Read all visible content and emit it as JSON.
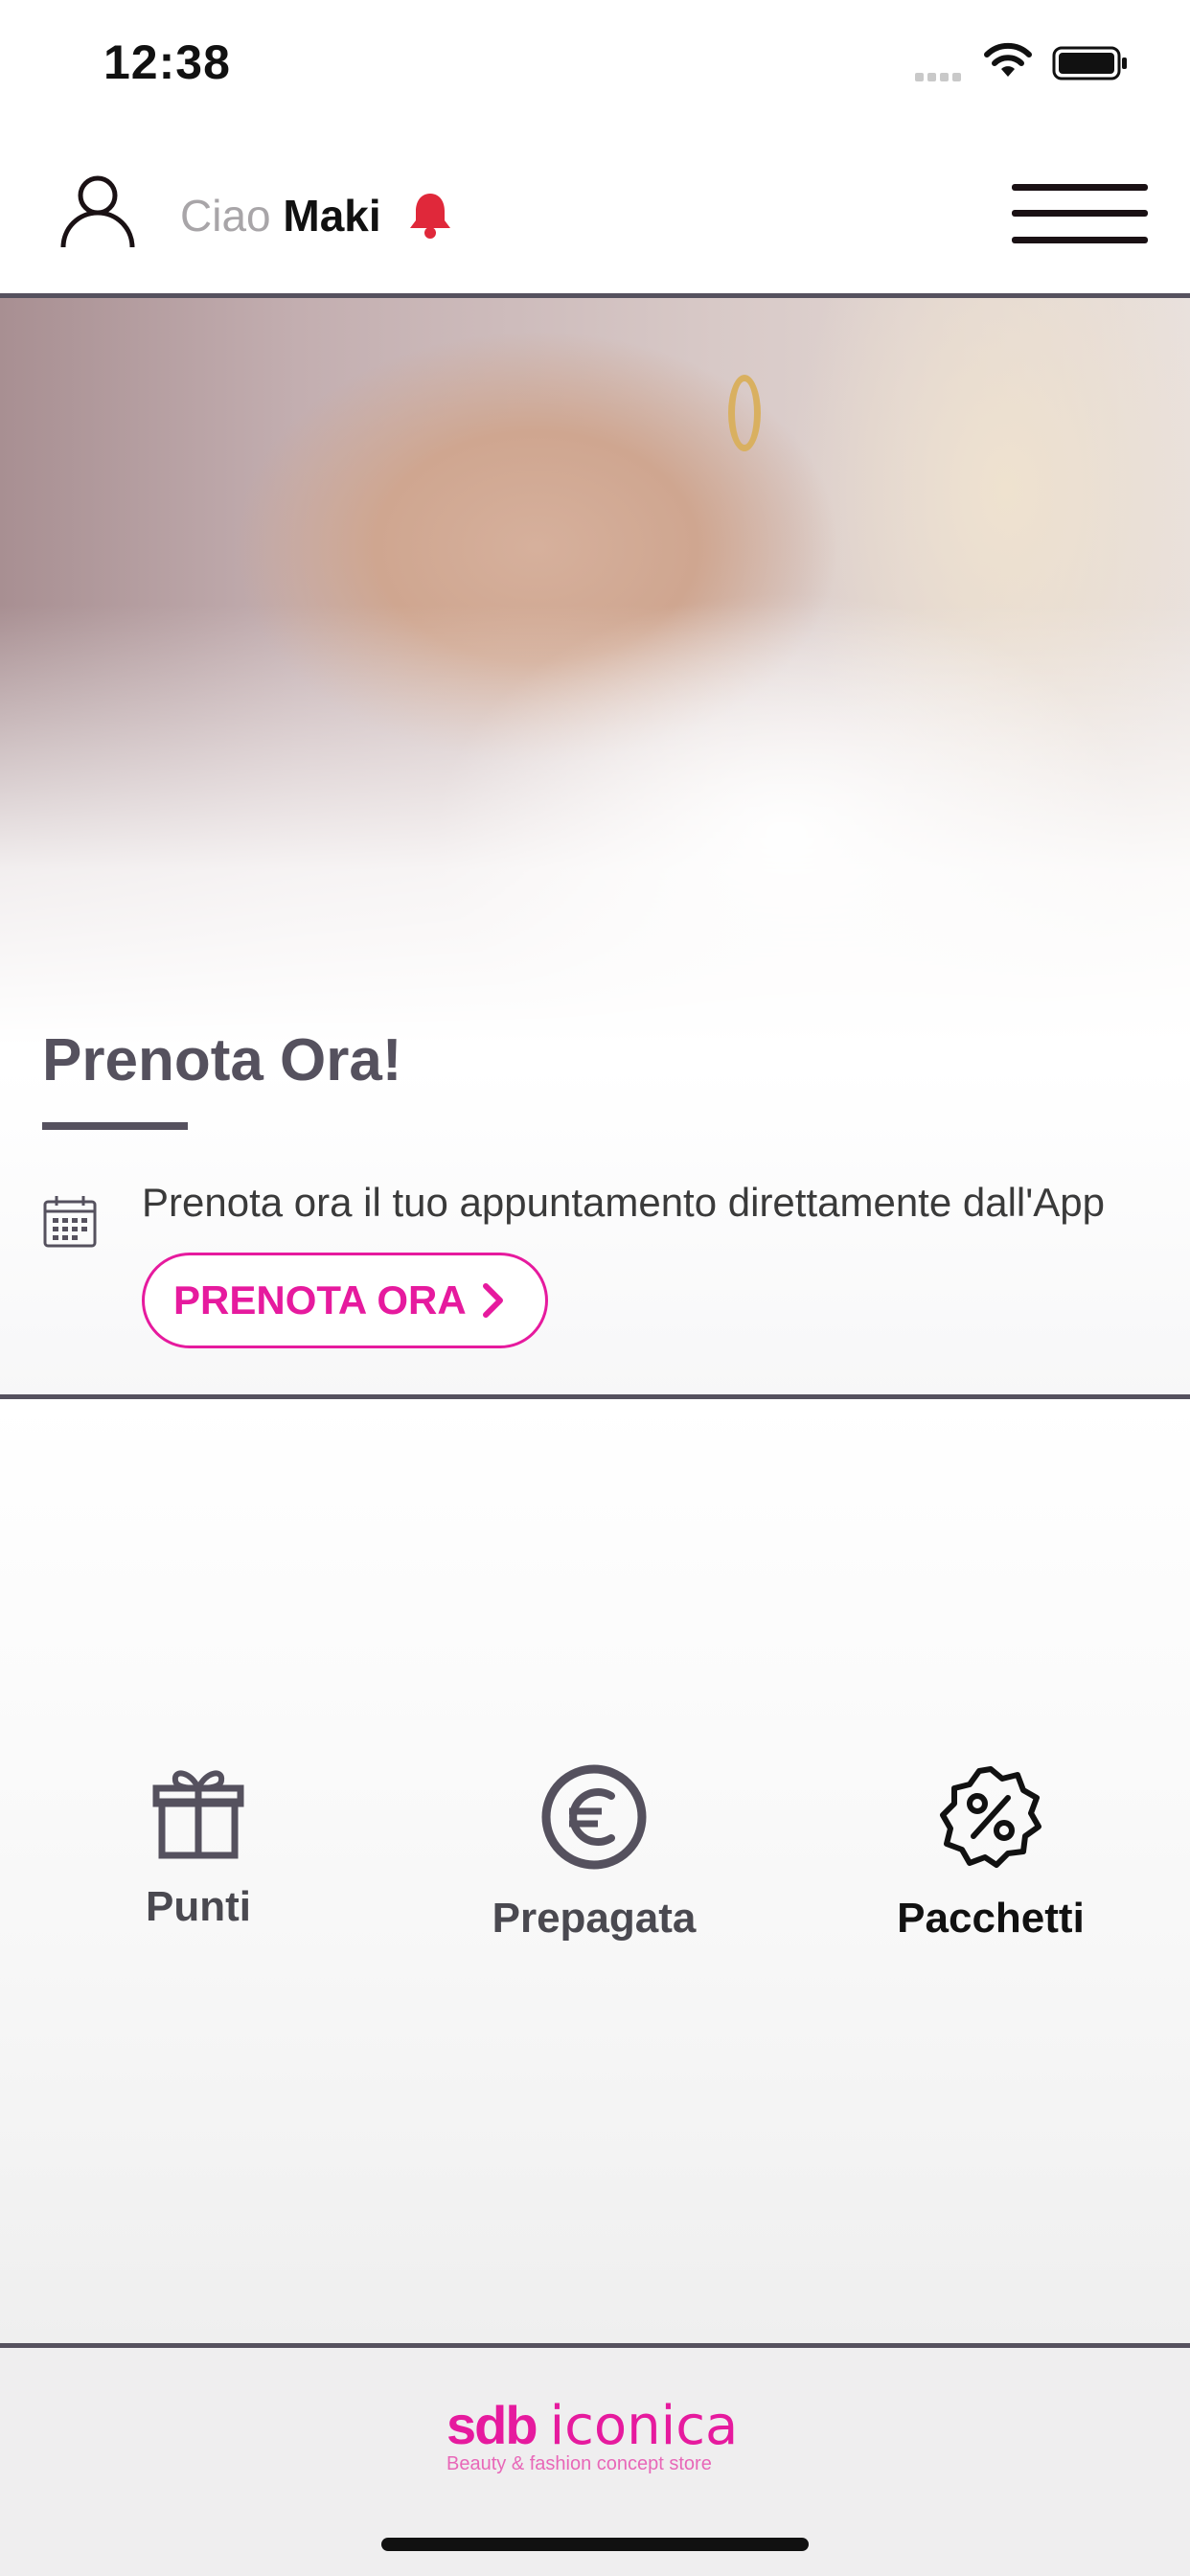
{
  "status_bar": {
    "time": "12:38"
  },
  "header": {
    "greeting": "Ciao",
    "user_name": "Maki"
  },
  "hero": {
    "title": "Prenota Ora!",
    "description": "Prenota ora il tuo appuntamento direttamente dall'App",
    "button_label": "PRENOTA ORA"
  },
  "tiles": [
    {
      "label": "Punti",
      "icon": "gift-icon"
    },
    {
      "label": "Prepagata",
      "icon": "euro-icon"
    },
    {
      "label": "Pacchetti",
      "icon": "discount-badge-icon"
    }
  ],
  "footer": {
    "brand_mark": "sdb",
    "brand_name": "iconica",
    "tagline": "Beauty & fashion concept store"
  },
  "colors": {
    "accent": "#e61a9e",
    "divider": "#55515e",
    "bell": "#e0283a"
  }
}
